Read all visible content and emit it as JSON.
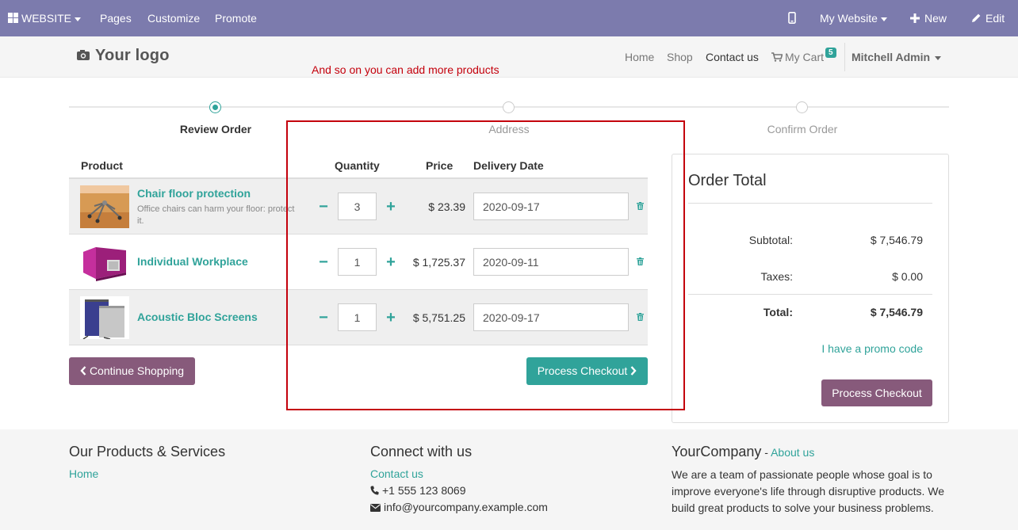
{
  "admin_bar": {
    "website_menu": "WEBSITE",
    "pages": "Pages",
    "customize": "Customize",
    "promote": "Promote",
    "my_website": "My Website",
    "new": "New",
    "edit": "Edit",
    "background_color": "#7c7bad"
  },
  "header": {
    "logo": "Your logo",
    "nav": [
      "Home",
      "Shop",
      "Contact us"
    ],
    "cart_label": "My Cart",
    "cart_count": "5",
    "user": "Mitchell Admin"
  },
  "annotation": {
    "note": "And so on you can add more products",
    "color": "#c4000c"
  },
  "wizard": {
    "steps": [
      "Review Order",
      "Address",
      "Confirm Order"
    ],
    "active_step": 0
  },
  "cart": {
    "headers": {
      "product": "Product",
      "quantity": "Quantity",
      "price": "Price",
      "delivery_date": "Delivery Date"
    },
    "rows": [
      {
        "name": "Chair floor protection",
        "description": "Office chairs can harm your floor: protect it.",
        "quantity": "3",
        "price": "$ 23.39",
        "delivery_date": "2020-09-17",
        "image_icon": "chair-floor-photo"
      },
      {
        "name": "Individual Workplace",
        "description": "",
        "quantity": "1",
        "price": "$ 1,725.37",
        "delivery_date": "2020-09-11",
        "image_icon": "workplace-photo"
      },
      {
        "name": "Acoustic Bloc Screens",
        "description": "",
        "quantity": "1",
        "price": "$ 5,751.25",
        "delivery_date": "2020-09-17",
        "image_icon": "screens-photo"
      }
    ],
    "continue_shopping": "Continue Shopping",
    "process_checkout": "Process Checkout"
  },
  "order_total": {
    "title": "Order Total",
    "subtotal_label": "Subtotal:",
    "subtotal": "$ 7,546.79",
    "taxes_label": "Taxes:",
    "taxes": "$ 0.00",
    "total_label": "Total:",
    "total": "$ 7,546.79",
    "promo_link": "I have a promo code",
    "process_checkout": "Process Checkout"
  },
  "footer": {
    "col1": {
      "title": "Our Products & Services",
      "link": "Home"
    },
    "col2": {
      "title": "Connect with us",
      "link": "Contact us",
      "phone": "+1 555 123 8069",
      "email": "info@yourcompany.example.com"
    },
    "col3": {
      "title": "YourCompany",
      "dash": " - ",
      "about": "About us",
      "text": "We are a team of passionate people whose goal is to improve everyone's life through disruptive products. We build great products to solve your business problems."
    }
  },
  "colors": {
    "accent": "#30a39a",
    "brand_purple": "#875a7b"
  }
}
